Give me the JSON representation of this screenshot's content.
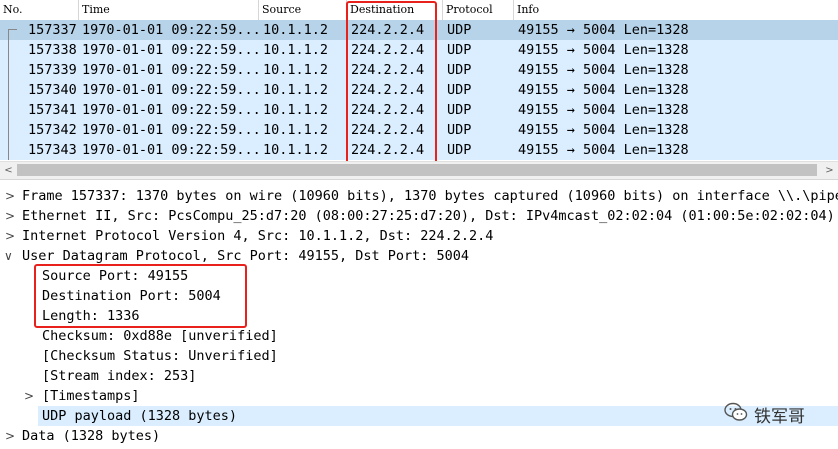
{
  "packet_list": {
    "columns": [
      "No.",
      "Time",
      "Source",
      "Destination",
      "Protocol",
      "Info"
    ],
    "rows": [
      {
        "no": "157337",
        "time": "1970-01-01 09:22:59...",
        "source": "10.1.1.2",
        "destination": "224.2.2.4",
        "protocol": "UDP",
        "info": "49155 → 5004 Len=1328"
      },
      {
        "no": "157338",
        "time": "1970-01-01 09:22:59...",
        "source": "10.1.1.2",
        "destination": "224.2.2.4",
        "protocol": "UDP",
        "info": "49155 → 5004 Len=1328"
      },
      {
        "no": "157339",
        "time": "1970-01-01 09:22:59...",
        "source": "10.1.1.2",
        "destination": "224.2.2.4",
        "protocol": "UDP",
        "info": "49155 → 5004 Len=1328"
      },
      {
        "no": "157340",
        "time": "1970-01-01 09:22:59...",
        "source": "10.1.1.2",
        "destination": "224.2.2.4",
        "protocol": "UDP",
        "info": "49155 → 5004 Len=1328"
      },
      {
        "no": "157341",
        "time": "1970-01-01 09:22:59...",
        "source": "10.1.1.2",
        "destination": "224.2.2.4",
        "protocol": "UDP",
        "info": "49155 → 5004 Len=1328"
      },
      {
        "no": "157342",
        "time": "1970-01-01 09:22:59...",
        "source": "10.1.1.2",
        "destination": "224.2.2.4",
        "protocol": "UDP",
        "info": "49155 → 5004 Len=1328"
      },
      {
        "no": "157343",
        "time": "1970-01-01 09:22:59...",
        "source": "10.1.1.2",
        "destination": "224.2.2.4",
        "protocol": "UDP",
        "info": "49155 → 5004 Len=1328"
      }
    ]
  },
  "scrollbar": {
    "left_arrow": "<",
    "right_arrow": ">"
  },
  "details": {
    "frame": "Frame 157337: 1370 bytes on wire (10960 bits), 1370 bytes captured (10960 bits) on interface \\\\.\\pipe\\",
    "ethernet": "Ethernet II, Src: PcsCompu_25:d7:20 (08:00:27:25:d7:20), Dst: IPv4mcast_02:02:04 (01:00:5e:02:02:04)",
    "ip": "Internet Protocol Version 4, Src: 10.1.1.2, Dst: 224.2.2.4",
    "udp": "User Datagram Protocol, Src Port: 49155, Dst Port: 5004",
    "udp_fields": {
      "source_port": "Source Port: 49155",
      "destination_port": "Destination Port: 5004",
      "length": "Length: 1336",
      "checksum": "Checksum: 0xd88e [unverified]",
      "checksum_status": "[Checksum Status: Unverified]",
      "stream_index": "[Stream index: 253]",
      "timestamps": "[Timestamps]",
      "payload": "UDP payload (1328 bytes)"
    },
    "data": "Data (1328 bytes)"
  },
  "watermark": {
    "text": "铁军哥",
    "icon": "wechat-icon"
  },
  "colors": {
    "row_bg": "#daeeff",
    "selected_row_bg": "#b7d3ea",
    "annotation_red": "#e8211c"
  }
}
